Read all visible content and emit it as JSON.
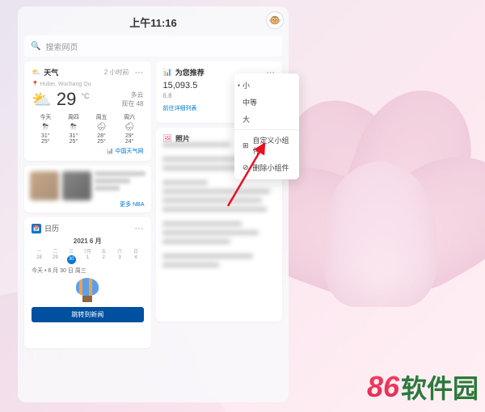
{
  "clock": "上午11:16",
  "search": {
    "placeholder": "搜索网页"
  },
  "weather": {
    "title": "天气",
    "updated": "2 小时前",
    "location": "Hubei, Wuchang Qu",
    "temp": "29",
    "unit": "°C",
    "condition": "多云",
    "feels": "现在 48",
    "days": [
      {
        "label": "今天",
        "hi": "31°",
        "lo": "25°",
        "icon": "⛈"
      },
      {
        "label": "周四",
        "hi": "31°",
        "lo": "25°",
        "icon": "⛈"
      },
      {
        "label": "周五",
        "hi": "28°",
        "lo": "25°",
        "icon": "🌧"
      },
      {
        "label": "周六",
        "hi": "29°",
        "lo": "24°",
        "icon": "🌧"
      }
    ],
    "source": "中国天气网"
  },
  "nba": {
    "footer": "更多 NBA"
  },
  "calendar": {
    "title": "日历",
    "month": "2021 6 月",
    "dow": [
      "一",
      "二",
      "三",
      "7月",
      "五",
      "六",
      "日"
    ],
    "row": [
      "28",
      "29",
      "30",
      "1",
      "2",
      "3",
      "4"
    ],
    "today_label": "今天 • 6 月 30 日 周三",
    "button": "跳转到新闻"
  },
  "recommend": {
    "title": "为您推荐",
    "value": "15,093.5",
    "sub": "6.8",
    "link": "前往详细列表"
  },
  "photos": {
    "title": "照片"
  },
  "menu": {
    "small": "小",
    "medium": "中等",
    "large": "大",
    "customize": "自定义小组件",
    "remove": "删除小组件"
  },
  "watermark": {
    "num": "86",
    "txt": "软件园"
  }
}
